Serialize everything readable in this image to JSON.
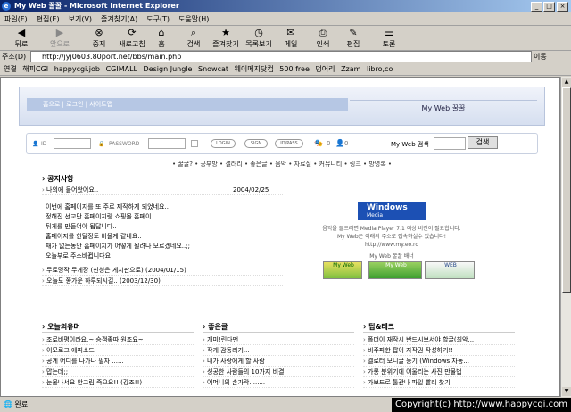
{
  "window": {
    "title": "My Web 꿀꿀 - Microsoft Internet Explorer"
  },
  "menu": [
    "파일(F)",
    "편집(E)",
    "보기(V)",
    "즐겨찾기(A)",
    "도구(T)",
    "도움말(H)"
  ],
  "toolbar": [
    {
      "label": "뒤로",
      "glyph": "◀"
    },
    {
      "label": "앞으로",
      "glyph": "▶"
    },
    {
      "label": "중지",
      "glyph": "⊗"
    },
    {
      "label": "새로고침",
      "glyph": "⟳"
    },
    {
      "label": "홈",
      "glyph": "⌂"
    },
    {
      "label": "검색",
      "glyph": "⌕"
    },
    {
      "label": "즐겨찾기",
      "glyph": "★"
    },
    {
      "label": "목록보기",
      "glyph": "◷"
    },
    {
      "label": "메일",
      "glyph": "✉"
    },
    {
      "label": "인쇄",
      "glyph": "⎙"
    },
    {
      "label": "편집",
      "glyph": "✎"
    },
    {
      "label": "토론",
      "glyph": "☰"
    }
  ],
  "address": {
    "label": "주소(D)",
    "url": "http://jyj0603.80port.net/bbs/main.php",
    "go": "이동"
  },
  "links": {
    "label": "연결",
    "items": [
      "해피CGI",
      "happycgi.job",
      "CGIMALL",
      "Design Jungle",
      "Snowcat",
      "웨이메지닷컴",
      "500 free",
      "덩어리",
      "Zzam",
      "libro,co"
    ]
  },
  "page": {
    "nav": "홈으로 | 로그인 | 사이트맵",
    "banner_title": "My Web 꿀꿀",
    "login": {
      "id_label": "ID",
      "pw_label": "PASSWORD",
      "btn_login": "LOGIN",
      "btn_sign": "SIGN",
      "btn_idpass": "ID/PASS",
      "count1": "0",
      "count2": "0",
      "search_label": "My Web 검색",
      "search_btn": "검색"
    },
    "mainmenu": "• 꿀꿀? • 공부방 • 갤러리 • 좋은글 • 음악 • 자료실 • 커뮤니티 • 링크 • 방명록 •",
    "notice": {
      "title": "공지사항",
      "first_item": "나의에 들어왔어요..",
      "first_date": "2004/02/25",
      "body": [
        "이번에 홈페이지를 또 주로 제작하게 되었네요..",
        "정해진 선교단 홈페이지랑 쇼핑몰 홈페이",
        "뒤게를 만들어야 됩답니다..",
        "홈페이지를 한달정도 비울게 같네요..",
        "재가 없는동안 홈페이지가 어떻게 될려나 모르겠네요..;;",
        "오늘부로 주소바뀝니다요"
      ],
      "items": [
        {
          "text": "무료명작 무게장 (신청은 게시판으로)",
          "date": "(2004/01/15)"
        },
        {
          "text": "오늘도 쫑가운 하루되시길..",
          "date": "(2003/12/30)"
        }
      ]
    },
    "right": {
      "wm_title": "Windows",
      "wm_sub": "Media",
      "lines": [
        "음악을 들으려면 Media Player 7.1 이상 버전이 필요합니다.",
        "My Web은 이래의 주소로 접속하실수 있습니다!",
        "http://www.my.eo.ro"
      ],
      "caption": "My Web 꿀꿀 배너",
      "banner1": "My Web",
      "banner2": "My Web",
      "banner3": "WEB"
    },
    "sections": [
      {
        "title": "오늘의유머",
        "items": [
          "조로비평이라요,~ 승객좋따 원조요~",
          "이모로그 에피소드",
          "공계 어디를 나가나 필자 ......",
          "맙는데;;",
          "눈물나서요 안그림 죽으요!! (강조!!)"
        ]
      },
      {
        "title": "좋은글",
        "items": [
          "개미!린다맨",
          "작게 감동리기...",
          "내가 사랑에게 할 사람",
          "성공한 사람들의 10가지 비결",
          "어머니의 손가락........"
        ]
      },
      {
        "title": "팁&테크",
        "items": [
          "폴더이 재작시 반드시보서야 할글(최악...",
          "비주파한 팝이 자작권 작성하기!!",
          "엘로터 모니글 등기 (Windows 자동...",
          "가롱 분위기에 어울리는 사진 만물법",
          "가보드로 툴관나 파일 빨리 찾기"
        ]
      }
    ]
  },
  "status": {
    "text": "완료",
    "copyright": "Copyright(c) http://www.happycgi.com"
  }
}
